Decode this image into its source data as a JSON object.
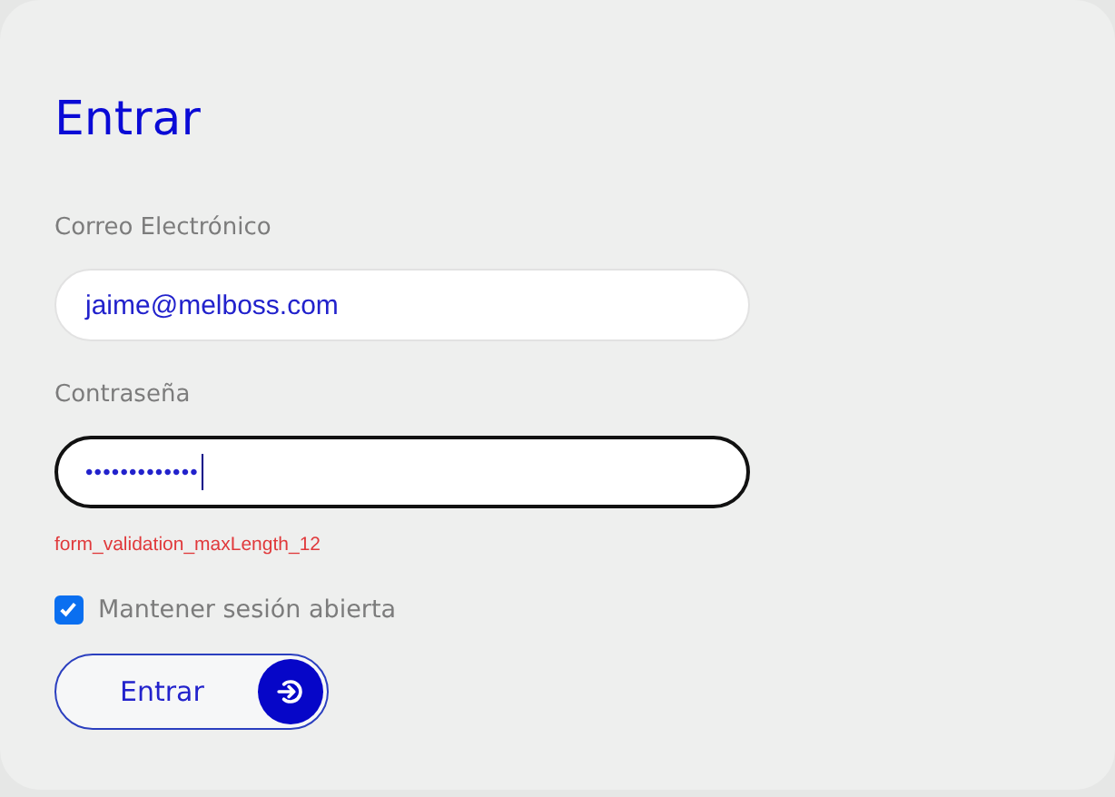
{
  "form": {
    "title": "Entrar",
    "fields": [
      {
        "label": "Correo Electrónico",
        "value": "jaime@melboss.com",
        "focused": false
      },
      {
        "label": "Contraseña",
        "value": "•••••••••••••",
        "focused": true,
        "error": "form_validation_maxLength_12"
      }
    ],
    "remember": {
      "label": "Mantener sesión abierta",
      "checked": true
    },
    "submit": {
      "label": "Entrar"
    }
  }
}
